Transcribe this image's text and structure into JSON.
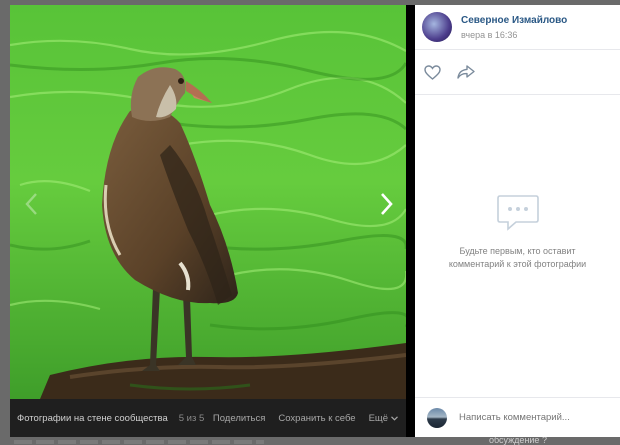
{
  "viewer": {
    "album_link": "Фотографии на стене сообщества",
    "counter": "5 из 5",
    "actions": {
      "share": "Поделиться",
      "save": "Сохранить к себе",
      "more": "Ещё"
    }
  },
  "post": {
    "author": "Северное Измайлово",
    "date": "вчера в 16:36"
  },
  "comments": {
    "empty_message": "Будьте первым, кто оставит комментарий к этой фотографии",
    "input_placeholder": "Написать комментарий..."
  },
  "background_page": {
    "partial_text": "обсуждение ?"
  },
  "colors": {
    "link": "#2a5885",
    "water": "#5cc33a",
    "panel_dark": "#1f1f1f"
  },
  "icons": {
    "prev": "chevron-left-icon",
    "next": "chevron-right-icon",
    "like": "heart-icon",
    "share": "share-arrow-icon",
    "empty": "speech-bubble-icon",
    "more": "chevron-down-icon"
  }
}
